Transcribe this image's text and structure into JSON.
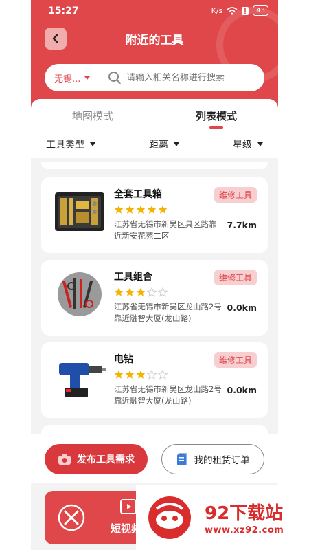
{
  "status_bar": {
    "time": "15:27",
    "net": "K/s",
    "battery": "43"
  },
  "header": {
    "title": "附近的工具"
  },
  "search": {
    "city": "无锡...",
    "placeholder": "请输入相关名称进行搜索"
  },
  "tabs": [
    {
      "label": "地图模式",
      "active": false
    },
    {
      "label": "列表模式",
      "active": true
    }
  ],
  "filters": [
    {
      "label": "工具类型"
    },
    {
      "label": "距离"
    },
    {
      "label": "星级"
    }
  ],
  "tools": [
    {
      "name": "全套工具箱",
      "tag": "维修工具",
      "rating": 5,
      "address": "江苏省无锡市新吴区具区路靠近新安花苑二区",
      "distance": "7.7km",
      "image": "toolbox"
    },
    {
      "name": "工具组合",
      "tag": "维修工具",
      "rating": 3,
      "address": "江苏省无锡市新吴区龙山路2号靠近融智大厦(龙山路)",
      "distance": "0.0km",
      "image": "tool-set"
    },
    {
      "name": "电钻",
      "tag": "维修工具",
      "rating": 3,
      "address": "江苏省无锡市新吴区龙山路2号靠近融智大厦(龙山路)",
      "distance": "0.0km",
      "image": "drill"
    }
  ],
  "bottom_actions": {
    "publish_label": "发布工具需求",
    "orders_label": "我的租赁订单"
  },
  "video_card": {
    "label": "短视频"
  },
  "watermark": {
    "title": "92下载站",
    "url": "www.xz92.com"
  },
  "colors": {
    "primary": "#e0474b",
    "tag_bg": "#f7cfd0",
    "star": "#f5b301"
  }
}
